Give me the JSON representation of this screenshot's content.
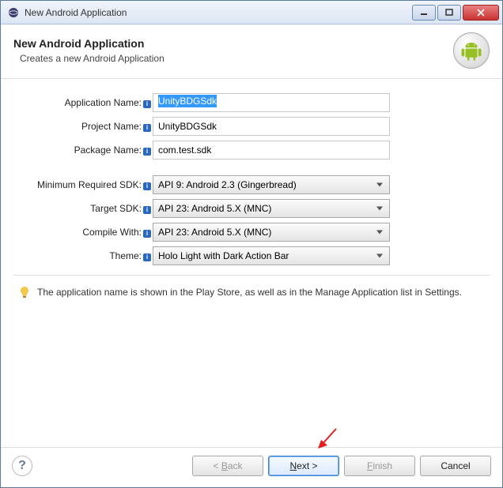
{
  "window": {
    "title": "New Android Application"
  },
  "header": {
    "title": "New Android Application",
    "subtitle": "Creates a new Android Application"
  },
  "form": {
    "appNameLabel": "Application Name:",
    "appNameValue": "UnityBDGSdk",
    "projectNameLabel": "Project Name:",
    "projectNameValue": "UnityBDGSdk",
    "packageNameLabel": "Package Name:",
    "packageNameValue": "com.test.sdk",
    "minSdkLabel": "Minimum Required SDK:",
    "minSdkValue": "API 9: Android 2.3 (Gingerbread)",
    "targetSdkLabel": "Target SDK:",
    "targetSdkValue": "API 23: Android 5.X (MNC)",
    "compileWithLabel": "Compile With:",
    "compileWithValue": "API 23: Android 5.X (MNC)",
    "themeLabel": "Theme:",
    "themeValue": "Holo Light with Dark Action Bar"
  },
  "hint": {
    "text": "The application name is shown in the Play Store, as well as in the Manage Application list in Settings."
  },
  "buttons": {
    "back": "< Back",
    "next": "Next >",
    "finish": "Finish",
    "cancel": "Cancel"
  }
}
